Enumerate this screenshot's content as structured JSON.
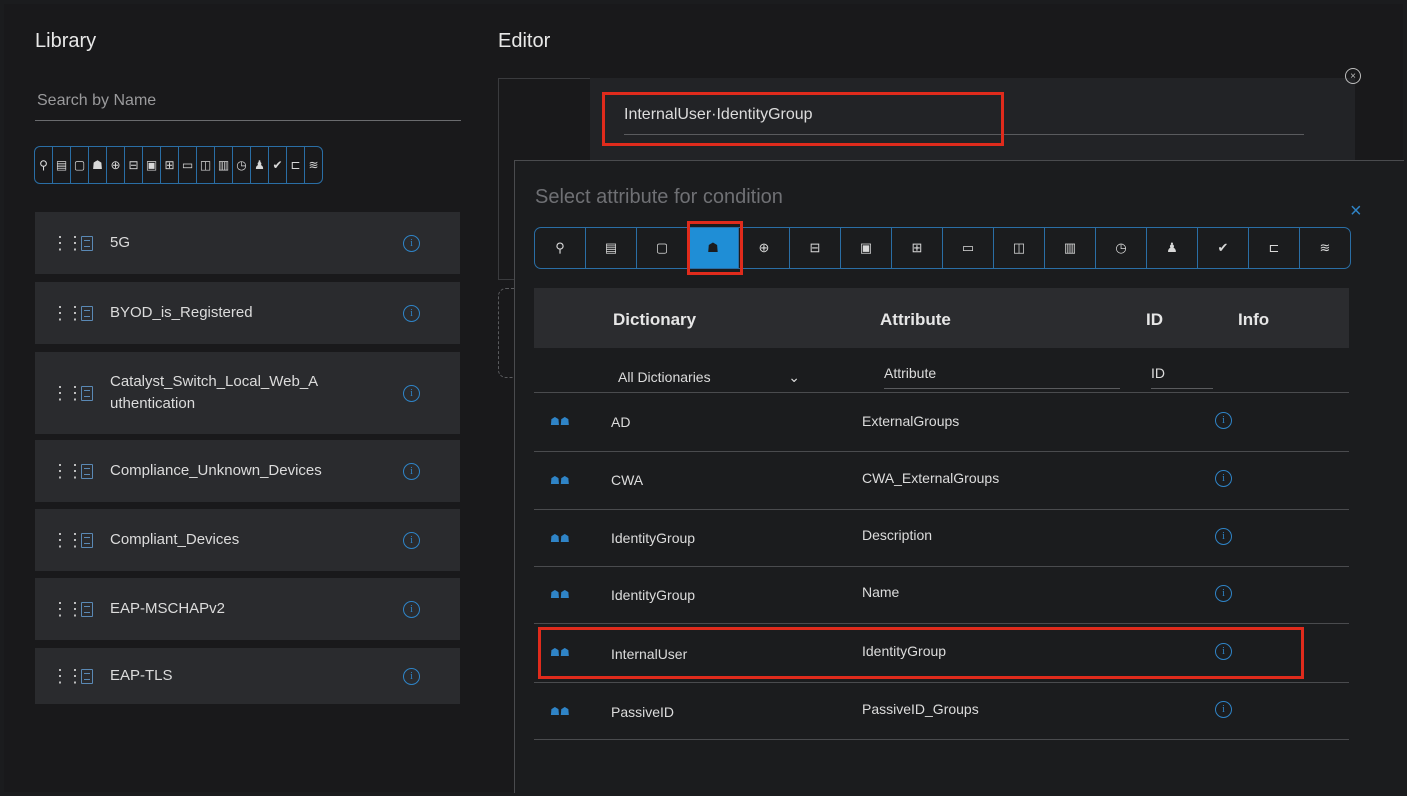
{
  "library": {
    "title": "Library",
    "search_placeholder": "Search by Name",
    "icons": [
      "location-icon",
      "device-icon",
      "square-icon",
      "group-icon",
      "globe-icon",
      "monitor-icon",
      "desktop-icon",
      "network-icon",
      "router-icon",
      "doc-icon",
      "server-icon",
      "clock-icon",
      "user-icon",
      "check-icon",
      "hierarchy-icon",
      "wifi-icon"
    ],
    "items": [
      {
        "name": "5G"
      },
      {
        "name": "BYOD_is_Registered"
      },
      {
        "name": "Catalyst_Switch_Local_Web_A uthentication"
      },
      {
        "name": "Compliance_Unknown_Devices"
      },
      {
        "name": "Compliant_Devices"
      },
      {
        "name": "EAP-MSCHAPv2"
      },
      {
        "name": "EAP-TLS"
      }
    ]
  },
  "editor": {
    "title": "Editor",
    "condition_value": "InternalUser·IdentityGroup"
  },
  "popup": {
    "title": "Select attribute for condition",
    "close": "×",
    "active_icon": "group-icon",
    "columns": {
      "dictionary": "Dictionary",
      "attribute": "Attribute",
      "id": "ID",
      "info": "Info"
    },
    "filters": {
      "dictionary": "All Dictionaries",
      "attribute": "Attribute",
      "id": "ID"
    },
    "rows": [
      {
        "dictionary": "AD",
        "attribute": "ExternalGroups"
      },
      {
        "dictionary": "CWA",
        "attribute": "CWA_ExternalGroups"
      },
      {
        "dictionary": "IdentityGroup",
        "attribute": "Description"
      },
      {
        "dictionary": "IdentityGroup",
        "attribute": "Name"
      },
      {
        "dictionary": "InternalUser",
        "attribute": "IdentityGroup",
        "highlighted": true
      },
      {
        "dictionary": "PassiveID",
        "attribute": "PassiveID_Groups"
      }
    ]
  },
  "colors": {
    "accent": "#1f8ed6",
    "highlight": "#e02b1c",
    "background": "#19191b"
  }
}
